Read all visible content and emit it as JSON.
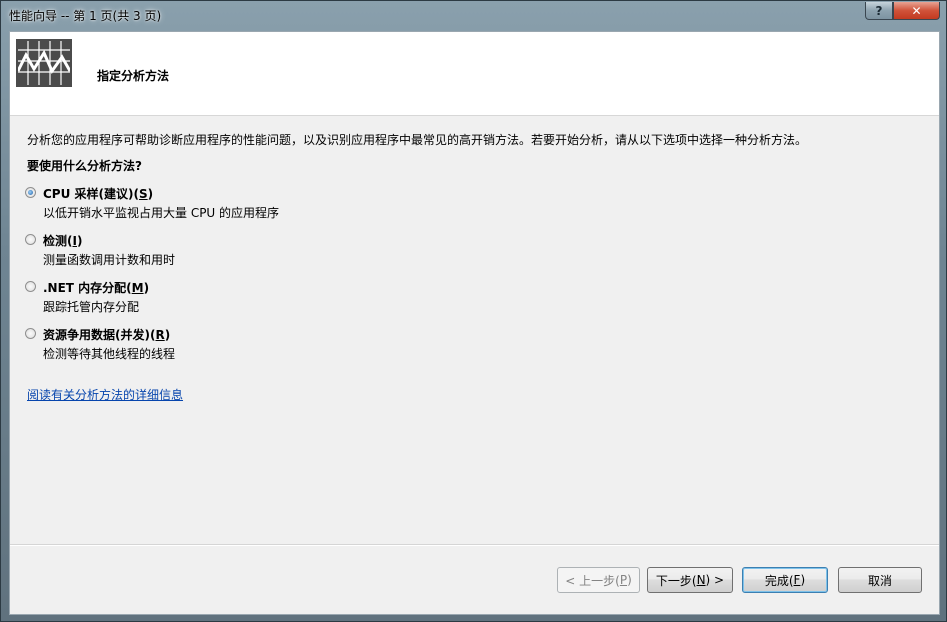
{
  "window": {
    "title": "性能向导 -- 第 1 页(共 3 页)",
    "help_label": "?",
    "close_label": "✕"
  },
  "header": {
    "title": "指定分析方法",
    "icon": "performance-chart-icon"
  },
  "description": "分析您的应用程序可帮助诊断应用程序的性能问题，以及识别应用程序中最常见的高开销方法。若要开始分析，请从以下选项中选择一种分析方法。",
  "question": "要使用什么分析方法?",
  "options": [
    {
      "label_main": "CPU 采样(建议)(",
      "accel": "S",
      "label_end": ")",
      "sub": "以低开销水平监视占用大量 CPU 的应用程序",
      "checked": true
    },
    {
      "label_main": "检测(",
      "accel": "I",
      "label_end": ")",
      "sub": "测量函数调用计数和用时",
      "checked": false
    },
    {
      "label_main": ".NET 内存分配(",
      "accel": "M",
      "label_end": ")",
      "sub": "跟踪托管内存分配",
      "checked": false
    },
    {
      "label_main": "资源争用数据(并发)(",
      "accel": "R",
      "label_end": ")",
      "sub": "检测等待其他线程的线程",
      "checked": false
    }
  ],
  "link": "阅读有关分析方法的详细信息",
  "buttons": {
    "prev": {
      "pre": "< 上一步(",
      "accel": "P",
      "post": ")"
    },
    "next": {
      "pre": "下一步(",
      "accel": "N",
      "post": ") >"
    },
    "finish": {
      "pre": "完成(",
      "accel": "F",
      "post": ")"
    },
    "cancel": "取消"
  }
}
